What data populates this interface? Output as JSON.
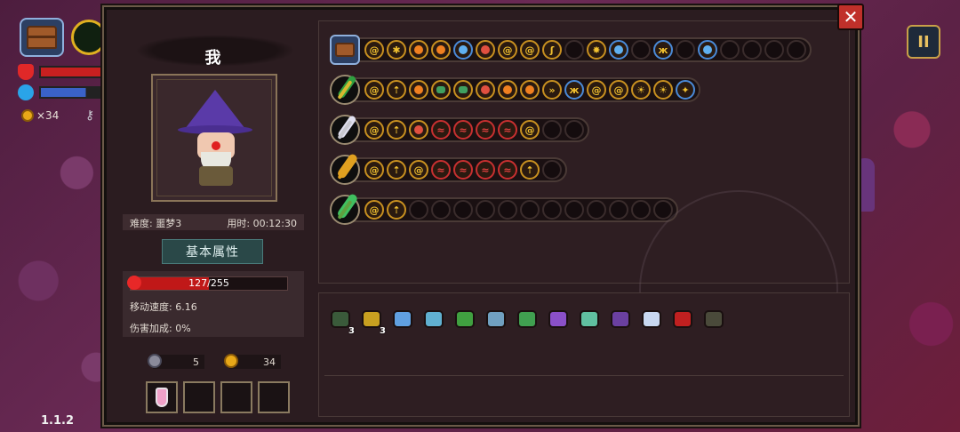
{
  "hud": {
    "coins": "×34",
    "version": "1.1.2",
    "pause_symbol": "II"
  },
  "panel": {
    "close_symbol": "✕",
    "character": {
      "name": "我",
      "difficulty": "难度: 噩梦3",
      "time": "用时: 00:12:30",
      "tab_label": "基本属性",
      "hp_current": 127,
      "hp_max": 255,
      "hp_text": "127/255",
      "move_speed": "移动速度: 6.16",
      "damage_bonus": "伤害加成: 0%",
      "keys": "5",
      "coins": "34"
    }
  },
  "weapons": [
    {
      "icon": "chest",
      "slots": [
        "spiral",
        "spark",
        "fire-red",
        "fire-red",
        "orb-blue",
        "orb-red",
        "spiral",
        "spiral",
        "fire",
        "empty",
        "burst",
        "orb-blue",
        "empty",
        "butterfly",
        "empty",
        "orb-blue",
        "empty",
        "empty",
        "empty",
        "empty"
      ]
    },
    {
      "icon": "staff-green",
      "slots": [
        "spiral",
        "arrow",
        "fire-red",
        "jar",
        "jar",
        "orb-red",
        "fire-red",
        "fire-red",
        "double-arrow",
        "butterfly",
        "spiral",
        "spiral",
        "sun",
        "sun",
        "magic"
      ]
    },
    {
      "icon": "staff-silver",
      "slots": [
        "spiral",
        "arrow",
        "orb-red",
        "wave",
        "wave",
        "wave",
        "wave",
        "spiral",
        "empty",
        "empty"
      ]
    },
    {
      "icon": "staff-gold",
      "slots": [
        "spiral",
        "arrow",
        "spiral",
        "wave",
        "wave",
        "wave",
        "wave",
        "arrow",
        "empty"
      ]
    },
    {
      "icon": "staff-vine",
      "slots": [
        "spiral",
        "arrow",
        "empty",
        "empty",
        "empty",
        "empty",
        "empty",
        "empty",
        "empty",
        "empty",
        "empty",
        "empty",
        "empty",
        "empty"
      ]
    }
  ],
  "items": [
    {
      "name": "cloak-item",
      "count": "3",
      "color": "#3a5a3a"
    },
    {
      "name": "antler-item",
      "count": "3",
      "color": "#c8a020"
    },
    {
      "name": "magnifier-item",
      "count": "",
      "color": "#60a0e0"
    },
    {
      "name": "boot-item",
      "count": "",
      "color": "#60b0d0"
    },
    {
      "name": "hat-item",
      "count": "",
      "color": "#40a040"
    },
    {
      "name": "scroll-item",
      "count": "",
      "color": "#70a0c0"
    },
    {
      "name": "leaf-item",
      "count": "",
      "color": "#40a050"
    },
    {
      "name": "wizard-hat-item",
      "count": "",
      "color": "#8a50c8"
    },
    {
      "name": "worm-item",
      "count": "",
      "color": "#60c0a0"
    },
    {
      "name": "robe-item",
      "count": "",
      "color": "#6a40a0"
    },
    {
      "name": "flower-item",
      "count": "",
      "color": "#c8d8f0"
    },
    {
      "name": "eye-item",
      "count": "",
      "color": "#c02020"
    },
    {
      "name": "mask-item",
      "count": "",
      "color": "#4a4a3a"
    }
  ],
  "colors": {
    "panel_bg": "#2b1c20",
    "hp": "#c01818",
    "accent_gold": "#c89020",
    "close": "#c0302a"
  }
}
